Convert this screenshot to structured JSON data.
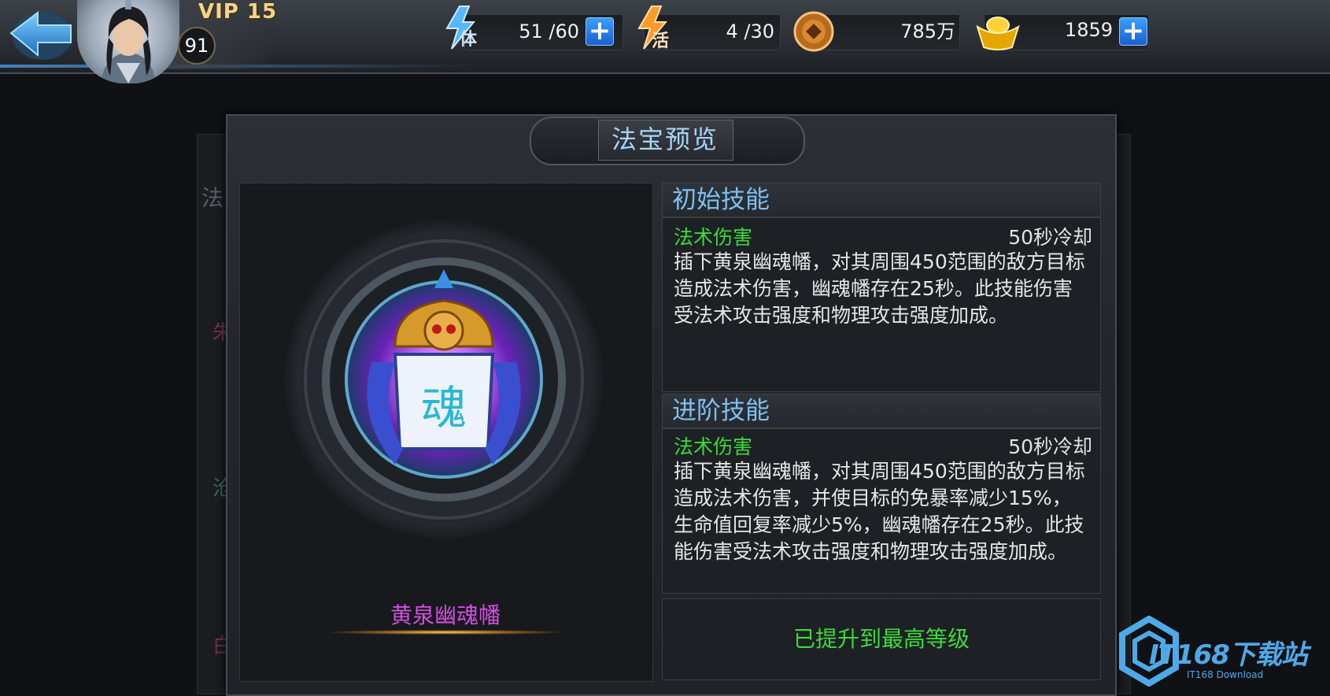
{
  "header": {
    "vip_label": "VIP 15",
    "level": "91",
    "stamina": {
      "icon_char": "体",
      "value": "51 /60"
    },
    "vitality": {
      "icon_char": "活",
      "value": "4 /30"
    },
    "coins": {
      "value": "785万"
    },
    "gold": {
      "value": "1859"
    },
    "plus_label": "+"
  },
  "background_tabs": [
    "法",
    "朱",
    "沧",
    "白"
  ],
  "modal": {
    "title": "法宝预览",
    "item_name": "黄泉幽魂幡",
    "emblem_char": "魂",
    "initial_skill": {
      "header": "初始技能",
      "name": "法术伤害",
      "cooldown": "50秒冷却",
      "desc_lines": [
        "插下黄泉幽魂幡，对其周围450范围的敌方目标",
        "造成法术伤害，幽魂幡存在25秒。此技能伤害",
        "受法术攻击强度和物理攻击强度加成。"
      ]
    },
    "advanced_skill": {
      "header": "进阶技能",
      "name": "法术伤害",
      "cooldown": "50秒冷却",
      "desc_lines": [
        "插下黄泉幽魂幡，对其周围450范围的敌方目标",
        "造成法术伤害，并使目标的免暴率减少15%，",
        "生命值回复率减少5%，幽魂幡存在25秒。此技",
        "能伤害受法术攻击强度和物理攻击强度加成。"
      ]
    },
    "max_level_text": "已提升到最高等级"
  },
  "watermark": {
    "main": "IT168下载站",
    "sub": "IT168 Download"
  },
  "colors": {
    "skill_name": "#3cdb3a",
    "section_header": "#7cc0f4",
    "item_name": "#d24ee3",
    "title": "#a9d4f4"
  },
  "icons": [
    "back-arrow-icon",
    "stamina-lightning-icon",
    "vitality-lightning-icon",
    "copper-coin-icon",
    "gold-ingot-icon",
    "plus-icon"
  ]
}
